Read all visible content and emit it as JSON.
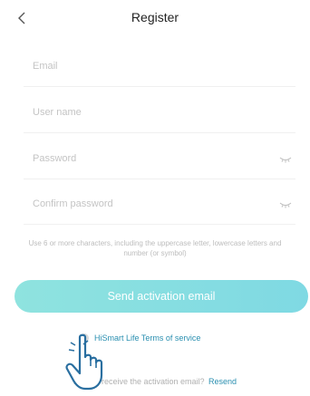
{
  "header": {
    "title": "Register",
    "back_icon": "chevron-left-icon"
  },
  "form": {
    "email_placeholder": "Email",
    "username_placeholder": "User name",
    "password_placeholder": "Password",
    "confirm_placeholder": "Confirm password",
    "password_toggle_icon": "eye-closed-icon",
    "hint": "Use 6 or more characters, including the uppercase letter, lowercase letters and number (or symbol)"
  },
  "actions": {
    "send_label": "Send activation email"
  },
  "terms": {
    "label": "HiSmart Life Terms of service"
  },
  "resend": {
    "prompt": "Did not receive the activation email?",
    "link": "Resend"
  },
  "colors": {
    "accent": "#8fe3df",
    "link": "#2a8fb0"
  },
  "overlay": {
    "pointer_icon": "hand-pointer-icon"
  }
}
